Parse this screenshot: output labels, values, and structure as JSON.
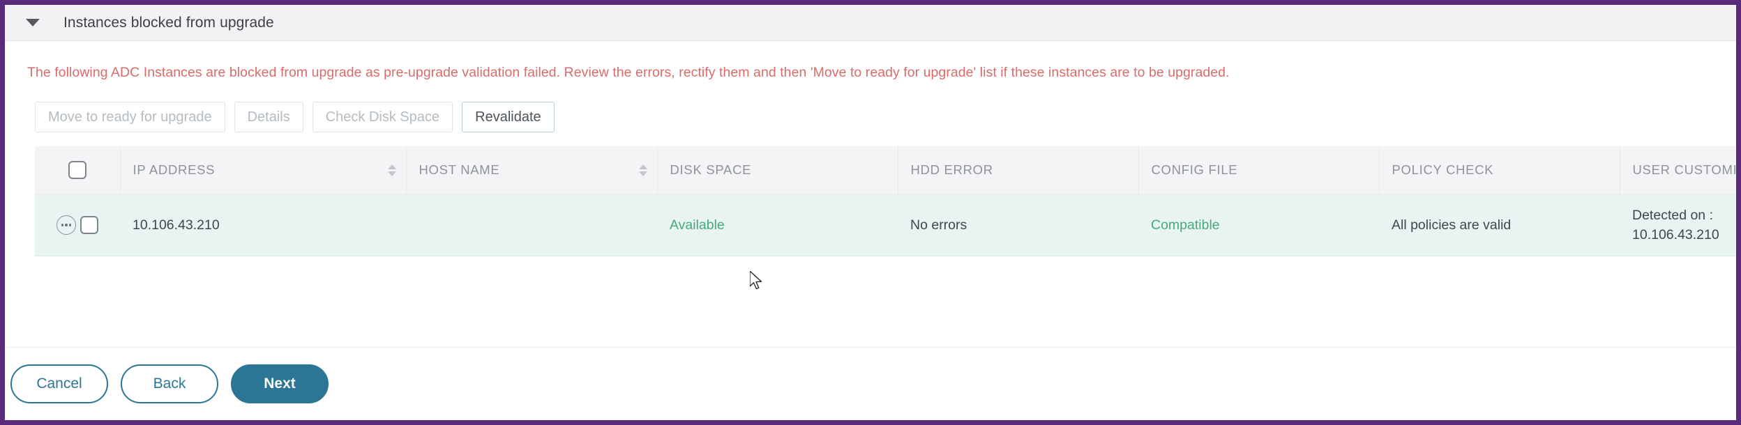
{
  "section": {
    "title": "Instances blocked from upgrade",
    "caret_icon": "chevron-down-icon",
    "border_color": "#5b2b7b"
  },
  "warning": {
    "text": "The following ADC Instances are blocked from upgrade as pre-upgrade validation failed. Review the errors, rectify them and then 'Move to ready for upgrade' list if these instances are to be upgraded.",
    "color": "#d96b6b"
  },
  "toolbar": {
    "buttons": [
      {
        "label": "Move to ready for upgrade",
        "enabled": false
      },
      {
        "label": "Details",
        "enabled": false
      },
      {
        "label": "Check Disk Space",
        "enabled": false
      },
      {
        "label": "Revalidate",
        "enabled": true
      }
    ]
  },
  "table": {
    "select_all_checkbox": false,
    "columns": [
      {
        "label": "IP ADDRESS",
        "sortable": true
      },
      {
        "label": "HOST NAME",
        "sortable": true
      },
      {
        "label": "DISK SPACE",
        "sortable": false
      },
      {
        "label": "HDD ERROR",
        "sortable": false
      },
      {
        "label": "CONFIG FILE",
        "sortable": false
      },
      {
        "label": "POLICY CHECK",
        "sortable": false
      },
      {
        "label": "USER CUSTOMIZATION",
        "sortable": false
      }
    ],
    "rows": [
      {
        "row_menu_icon": "ellipsis-circle-icon",
        "checked": false,
        "ip_address": "10.106.43.210",
        "host_name": "",
        "disk_space": "Available",
        "disk_space_color": "#49a87c",
        "hdd_error": "No errors",
        "config_file": "Compatible",
        "config_file_color": "#49a87c",
        "policy_check": "All policies are valid",
        "user_customization_line1": "Detected on :",
        "user_customization_line2": "10.106.43.210"
      }
    ]
  },
  "footer": {
    "cancel_label": "Cancel",
    "back_label": "Back",
    "next_label": "Next",
    "accent_color": "#2d7595"
  }
}
